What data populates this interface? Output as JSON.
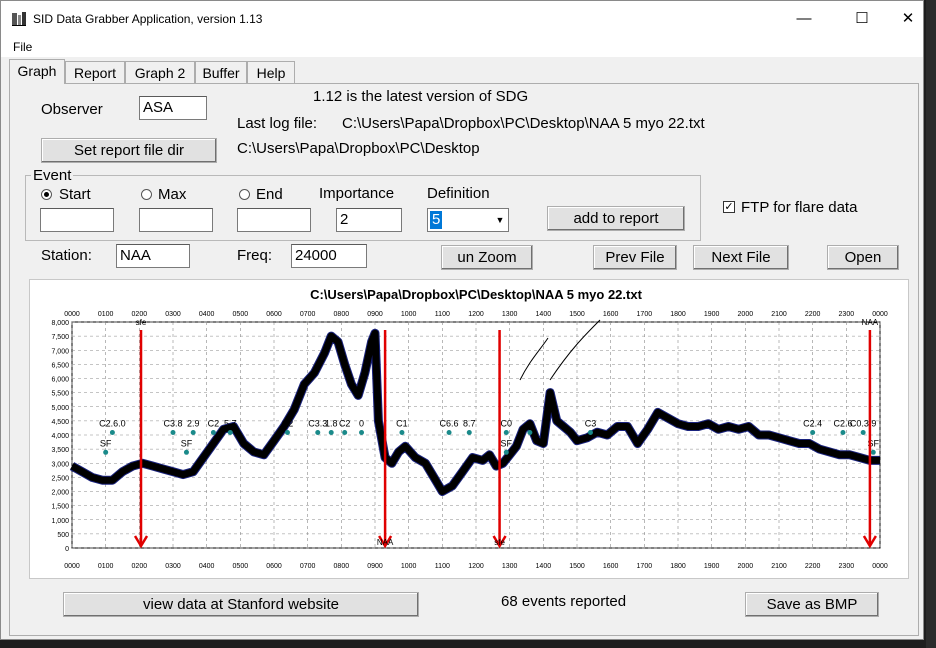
{
  "window": {
    "title": "SID Data Grabber Application, version 1.13",
    "minimize": "—",
    "maximize": "☐",
    "close": "✕"
  },
  "menu": {
    "file": "File"
  },
  "tabs": [
    "Graph",
    "Report",
    "Graph 2",
    "Buffer",
    "Help"
  ],
  "header": {
    "latest_version": "1.12 is the latest version of SDG",
    "last_log_label": "Last log file:",
    "last_log_path": "C:\\Users\\Papa\\Dropbox\\PC\\Desktop\\NAA 5 myo 22.txt",
    "report_dir": "C:\\Users\\Papa\\Dropbox\\PC\\Desktop"
  },
  "observer": {
    "label": "Observer",
    "value": "ASA"
  },
  "set_report_dir_button": "Set report file dir",
  "event": {
    "group_label": "Event",
    "start_label": "Start",
    "max_label": "Max",
    "end_label": "End",
    "importance_label": "Importance",
    "importance_value": "2",
    "definition_label": "Definition",
    "definition_value": "5",
    "start_value": "",
    "max_value": "",
    "end_value": ""
  },
  "add_to_report_button": "add to report",
  "ftp_label": "FTP for flare data",
  "station": {
    "label": "Station:",
    "value": "NAA"
  },
  "freq": {
    "label": "Freq:",
    "value": "24000"
  },
  "unzoom_button": "un Zoom",
  "prev_file_button": "Prev File",
  "next_file_button": "Next File",
  "open_button": "Open",
  "stanford_button": "view data at Stanford website",
  "events_reported": "68 events reported",
  "save_bmp_button": "Save as BMP",
  "colors": {
    "signal": "#000000",
    "signal_shadow": "#1a237e",
    "event_marker": "#1a8a8a",
    "arrow": "#e00000",
    "grid": "#777777"
  },
  "chart_data": {
    "type": "line",
    "title": "C:\\Users\\Papa\\Dropbox\\PC\\Desktop\\NAA 5 myo 22.txt",
    "xlabel": "",
    "ylabel": "",
    "x_tick_labels": [
      "0000",
      "0100",
      "0200",
      "0300",
      "0400",
      "0500",
      "0600",
      "0700",
      "0800",
      "0900",
      "1000",
      "1100",
      "1200",
      "1300",
      "1400",
      "1500",
      "1600",
      "1700",
      "1800",
      "1900",
      "2000",
      "2100",
      "2200",
      "2300",
      "0000"
    ],
    "y_tick_labels": [
      "8,000",
      "7,500",
      "7,000",
      "6,500",
      "6,000",
      "5,500",
      "5,000",
      "4,500",
      "4,000",
      "3,500",
      "3,000",
      "2,500",
      "2,000",
      "1,500",
      "1,000",
      "500",
      "0"
    ],
    "ylim": [
      0,
      8000
    ],
    "xlim": [
      0,
      24
    ],
    "grid": true,
    "series": [
      {
        "x": [
          0,
          0.3,
          0.6,
          0.9,
          1.2,
          1.5,
          1.8,
          2.1,
          2.4,
          2.7,
          3.0,
          3.3,
          3.6,
          3.9,
          4.2,
          4.5,
          4.8,
          5.1,
          5.4,
          5.7,
          6.0,
          6.3,
          6.6,
          6.9,
          7.2,
          7.5,
          7.7,
          7.9,
          8.1,
          8.3,
          8.5,
          8.7,
          8.9,
          9.0,
          9.1,
          9.3,
          9.5,
          9.7,
          9.9,
          10.2,
          10.5,
          10.8,
          11.0,
          11.3,
          11.6,
          11.9,
          12.2,
          12.4,
          12.6,
          12.8,
          13.0,
          13.2,
          13.4,
          13.6,
          13.8,
          14.0,
          14.2,
          14.4,
          14.6,
          14.8,
          15.0,
          15.3,
          15.6,
          15.9,
          16.2,
          16.5,
          16.8,
          17.1,
          17.4,
          17.7,
          18.0,
          18.3,
          18.6,
          18.9,
          19.2,
          19.5,
          19.8,
          20.1,
          20.4,
          20.7,
          21.0,
          21.3,
          21.6,
          21.9,
          22.2,
          22.5,
          22.8,
          23.1,
          23.4,
          23.7,
          24.0
        ],
        "y": [
          2900,
          2700,
          2500,
          2400,
          2400,
          2700,
          2900,
          3000,
          2900,
          2800,
          2700,
          2600,
          2700,
          3200,
          3700,
          4200,
          4300,
          3700,
          3400,
          3300,
          3800,
          4300,
          4900,
          5800,
          6200,
          6900,
          7500,
          7300,
          6500,
          5800,
          5400,
          6200,
          7300,
          7600,
          4500,
          3200,
          3000,
          3400,
          3600,
          3200,
          3000,
          2400,
          2000,
          2200,
          2700,
          3200,
          3100,
          3300,
          2900,
          3000,
          3300,
          3600,
          4200,
          4400,
          3800,
          3700,
          5500,
          4500,
          4300,
          4100,
          3800,
          3900,
          4100,
          4000,
          4300,
          4300,
          3700,
          4200,
          4800,
          4600,
          4400,
          4300,
          4300,
          4400,
          4200,
          4300,
          4200,
          4300,
          4000,
          4000,
          3900,
          3800,
          3700,
          3700,
          3500,
          3400,
          3300,
          3300,
          3200,
          3100,
          3100
        ]
      }
    ],
    "markers": [
      {
        "x": 2.05,
        "label_top": "sfe",
        "label_bottom": ""
      },
      {
        "x": 9.3,
        "label_top": "",
        "label_bottom": "NAA"
      },
      {
        "x": 12.7,
        "label_top": "",
        "label_bottom": "sfe"
      },
      {
        "x": 23.7,
        "label_top": "NAA",
        "label_bottom": ""
      }
    ],
    "annotations": [
      {
        "x": 1.2,
        "y": 4300,
        "text": "C2.6.0"
      },
      {
        "x": 3.0,
        "y": 4300,
        "text": "C3.8"
      },
      {
        "x": 3.6,
        "y": 4300,
        "text": "2.9"
      },
      {
        "x": 4.2,
        "y": 4300,
        "text": "C2"
      },
      {
        "x": 4.7,
        "y": 4300,
        "text": "5.7"
      },
      {
        "x": 6.4,
        "y": 4300,
        "text": "C2"
      },
      {
        "x": 7.3,
        "y": 4300,
        "text": "C3.3"
      },
      {
        "x": 7.7,
        "y": 4300,
        "text": "1.8"
      },
      {
        "x": 8.1,
        "y": 4300,
        "text": "C2"
      },
      {
        "x": 8.6,
        "y": 4300,
        "text": "0"
      },
      {
        "x": 9.8,
        "y": 4300,
        "text": "C1"
      },
      {
        "x": 11.2,
        "y": 4300,
        "text": "C6.6"
      },
      {
        "x": 11.8,
        "y": 4300,
        "text": "8.7"
      },
      {
        "x": 12.9,
        "y": 4300,
        "text": "C0"
      },
      {
        "x": 13.6,
        "y": 4300,
        "text": "2"
      },
      {
        "x": 15.4,
        "y": 4300,
        "text": "C3"
      },
      {
        "x": 22.0,
        "y": 4300,
        "text": "C2.4"
      },
      {
        "x": 22.9,
        "y": 4300,
        "text": "C2.6"
      },
      {
        "x": 23.5,
        "y": 4300,
        "text": "C0.3.9"
      },
      {
        "x": 1.0,
        "y": 3600,
        "text": "SF"
      },
      {
        "x": 3.4,
        "y": 3600,
        "text": "SF"
      },
      {
        "x": 12.9,
        "y": 3600,
        "text": "SF"
      },
      {
        "x": 23.8,
        "y": 3600,
        "text": "SF"
      }
    ]
  }
}
